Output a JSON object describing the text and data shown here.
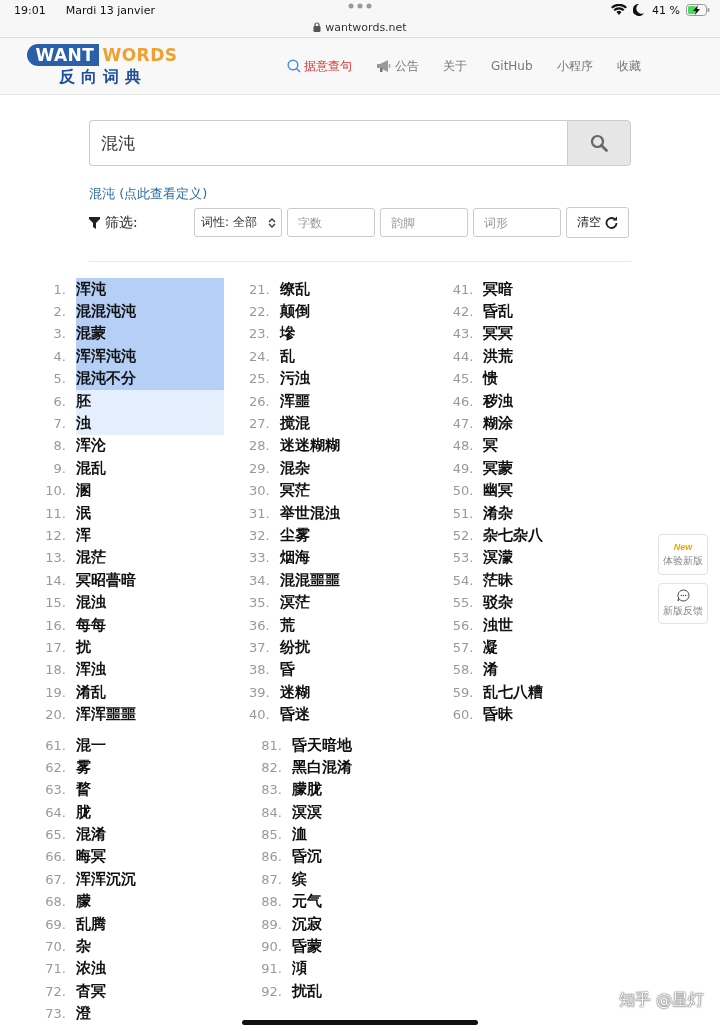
{
  "status_bar": {
    "time": "19:01",
    "date": "Mardi 13 janvier",
    "battery": "41 %"
  },
  "address_bar": {
    "url": "wantwords.net"
  },
  "logo": {
    "left": "WANT",
    "right": "WORDS",
    "subtitle": "反向词典"
  },
  "nav": [
    {
      "label": "据意查句",
      "selected": true
    },
    {
      "label": "公告",
      "selected": false
    },
    {
      "label": "关于",
      "selected": false
    },
    {
      "label": "GitHub",
      "selected": false
    },
    {
      "label": "小程序",
      "selected": false
    },
    {
      "label": "收藏",
      "selected": false
    }
  ],
  "search": {
    "value": "混沌"
  },
  "definition_link": "混沌 (点此查看定义)",
  "filter": {
    "label": "筛选:",
    "select": "词性: 全部",
    "fields": [
      {
        "placeholder": "字数"
      },
      {
        "placeholder": "韵脚"
      },
      {
        "placeholder": "词形"
      }
    ],
    "clear": "清空"
  },
  "results": [
    {
      "columns": [
        [
          {
            "num": "1.",
            "word": "浑沌",
            "kind": "strong"
          },
          {
            "num": "2.",
            "word": "混混沌沌",
            "kind": "strong"
          },
          {
            "num": "3.",
            "word": "混蒙",
            "kind": "strong"
          },
          {
            "num": "4.",
            "word": "浑浑沌沌",
            "kind": "strong"
          },
          {
            "num": "5.",
            "word": "混沌不分",
            "kind": "strong"
          },
          {
            "num": "6.",
            "word": "胚",
            "kind": "light"
          },
          {
            "num": "7.",
            "word": "浊",
            "kind": "light"
          },
          {
            "num": "8.",
            "word": "浑沦",
            "kind": "plain"
          },
          {
            "num": "9.",
            "word": "混乱",
            "kind": "plain"
          },
          {
            "num": "10.",
            "word": "溷",
            "kind": "plain"
          },
          {
            "num": "11.",
            "word": "泯",
            "kind": "plain"
          },
          {
            "num": "12.",
            "word": "浑",
            "kind": "plain"
          },
          {
            "num": "13.",
            "word": "混茫",
            "kind": "plain"
          },
          {
            "num": "14.",
            "word": "冥昭瞢暗",
            "kind": "plain"
          },
          {
            "num": "15.",
            "word": "混浊",
            "kind": "plain"
          },
          {
            "num": "16.",
            "word": "每每",
            "kind": "plain"
          },
          {
            "num": "17.",
            "word": "扰",
            "kind": "plain"
          },
          {
            "num": "18.",
            "word": "浑浊",
            "kind": "plain"
          },
          {
            "num": "19.",
            "word": "淆乱",
            "kind": "plain"
          },
          {
            "num": "20.",
            "word": "浑浑噩噩",
            "kind": "plain"
          }
        ],
        [
          {
            "num": "21.",
            "word": "缭乱",
            "kind": "plain"
          },
          {
            "num": "22.",
            "word": "颠倒",
            "kind": "plain"
          },
          {
            "num": "23.",
            "word": "墋",
            "kind": "plain"
          },
          {
            "num": "24.",
            "word": "乱",
            "kind": "plain"
          },
          {
            "num": "25.",
            "word": "污浊",
            "kind": "plain"
          },
          {
            "num": "26.",
            "word": "浑噩",
            "kind": "plain"
          },
          {
            "num": "27.",
            "word": "搅混",
            "kind": "plain"
          },
          {
            "num": "28.",
            "word": "迷迷糊糊",
            "kind": "plain"
          },
          {
            "num": "29.",
            "word": "混杂",
            "kind": "plain"
          },
          {
            "num": "30.",
            "word": "冥茫",
            "kind": "plain"
          },
          {
            "num": "31.",
            "word": "举世混浊",
            "kind": "plain"
          },
          {
            "num": "32.",
            "word": "尘雾",
            "kind": "plain"
          },
          {
            "num": "33.",
            "word": "烟海",
            "kind": "plain"
          },
          {
            "num": "34.",
            "word": "混混噩噩",
            "kind": "plain"
          },
          {
            "num": "35.",
            "word": "溟茫",
            "kind": "plain"
          },
          {
            "num": "36.",
            "word": "荒",
            "kind": "plain"
          },
          {
            "num": "37.",
            "word": "纷扰",
            "kind": "plain"
          },
          {
            "num": "38.",
            "word": "昏",
            "kind": "plain"
          },
          {
            "num": "39.",
            "word": "迷糊",
            "kind": "plain"
          },
          {
            "num": "40.",
            "word": "昏迷",
            "kind": "plain"
          }
        ],
        [
          {
            "num": "41.",
            "word": "冥暗",
            "kind": "plain"
          },
          {
            "num": "42.",
            "word": "昏乱",
            "kind": "plain"
          },
          {
            "num": "43.",
            "word": "冥冥",
            "kind": "plain"
          },
          {
            "num": "44.",
            "word": "洪荒",
            "kind": "plain"
          },
          {
            "num": "45.",
            "word": "愦",
            "kind": "plain"
          },
          {
            "num": "46.",
            "word": "秽浊",
            "kind": "plain"
          },
          {
            "num": "47.",
            "word": "糊涂",
            "kind": "plain"
          },
          {
            "num": "48.",
            "word": "冥",
            "kind": "plain"
          },
          {
            "num": "49.",
            "word": "冥蒙",
            "kind": "plain"
          },
          {
            "num": "50.",
            "word": "幽冥",
            "kind": "plain"
          },
          {
            "num": "51.",
            "word": "淆杂",
            "kind": "plain"
          },
          {
            "num": "52.",
            "word": "杂七杂八",
            "kind": "plain"
          },
          {
            "num": "53.",
            "word": "溟濛",
            "kind": "plain"
          },
          {
            "num": "54.",
            "word": "茫昧",
            "kind": "plain"
          },
          {
            "num": "55.",
            "word": "驳杂",
            "kind": "plain"
          },
          {
            "num": "56.",
            "word": "浊世",
            "kind": "plain"
          },
          {
            "num": "57.",
            "word": "凝",
            "kind": "plain"
          },
          {
            "num": "58.",
            "word": "淆",
            "kind": "plain"
          },
          {
            "num": "59.",
            "word": "乱七八糟",
            "kind": "plain"
          },
          {
            "num": "60.",
            "word": "昏昧",
            "kind": "plain"
          }
        ]
      ]
    },
    {
      "columns": [
        [
          {
            "num": "61.",
            "word": "混一",
            "kind": "plain"
          },
          {
            "num": "62.",
            "word": "雾",
            "kind": "plain"
          },
          {
            "num": "63.",
            "word": "瞀",
            "kind": "plain"
          },
          {
            "num": "64.",
            "word": "胧",
            "kind": "plain"
          },
          {
            "num": "65.",
            "word": "混淆",
            "kind": "plain"
          },
          {
            "num": "66.",
            "word": "晦冥",
            "kind": "plain"
          },
          {
            "num": "67.",
            "word": "浑浑沉沉",
            "kind": "plain"
          },
          {
            "num": "68.",
            "word": "朦",
            "kind": "plain"
          },
          {
            "num": "69.",
            "word": "乱腾",
            "kind": "plain"
          },
          {
            "num": "70.",
            "word": "杂",
            "kind": "plain"
          },
          {
            "num": "71.",
            "word": "浓浊",
            "kind": "plain"
          },
          {
            "num": "72.",
            "word": "杳冥",
            "kind": "plain"
          },
          {
            "num": "73.",
            "word": "澄",
            "kind": "plain"
          }
        ],
        [
          {
            "num": "81.",
            "word": "昏天暗地",
            "kind": "plain"
          },
          {
            "num": "82.",
            "word": "黑白混淆",
            "kind": "plain"
          },
          {
            "num": "83.",
            "word": "朦胧",
            "kind": "plain"
          },
          {
            "num": "84.",
            "word": "溟溟",
            "kind": "plain"
          },
          {
            "num": "85.",
            "word": "洫",
            "kind": "plain"
          },
          {
            "num": "86.",
            "word": "昏沉",
            "kind": "plain"
          },
          {
            "num": "87.",
            "word": "缤",
            "kind": "plain"
          },
          {
            "num": "88.",
            "word": "元气",
            "kind": "plain"
          },
          {
            "num": "89.",
            "word": "沉寂",
            "kind": "plain"
          },
          {
            "num": "90.",
            "word": "昏蒙",
            "kind": "plain"
          },
          {
            "num": "91.",
            "word": "澒",
            "kind": "plain"
          },
          {
            "num": "92.",
            "word": "扰乱",
            "kind": "plain"
          }
        ]
      ]
    }
  ],
  "float_buttons": [
    {
      "kind": "new",
      "badge": "New",
      "label": "体验新版"
    },
    {
      "kind": "chat",
      "label": "新版反馈"
    }
  ],
  "watermark_text": "知乎 @星灯"
}
